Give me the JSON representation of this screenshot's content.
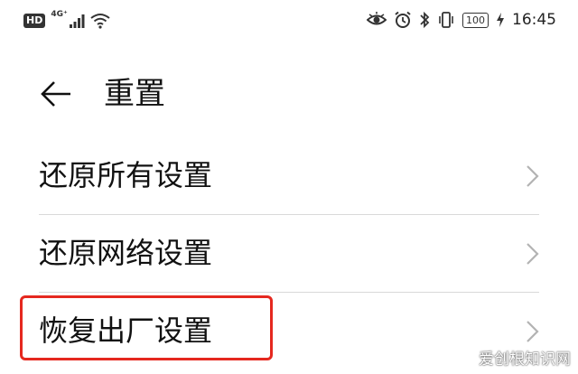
{
  "status_bar": {
    "hd_badge": "HD",
    "network": "4G⁺",
    "battery": "100",
    "time": "16:45",
    "icons": [
      "signal-icon",
      "wifi-icon",
      "eye-icon",
      "alarm-icon",
      "bluetooth-icon",
      "vibrate-icon",
      "charging-icon"
    ]
  },
  "header": {
    "title": "重置",
    "back_icon": "arrow-left-icon"
  },
  "menu": {
    "items": [
      {
        "label": "还原所有设置"
      },
      {
        "label": "还原网络设置"
      },
      {
        "label": "恢复出厂设置"
      }
    ]
  },
  "colors": {
    "highlight": "#e5281f",
    "divider": "#d9d9d9",
    "chevron": "#b3b3b3"
  },
  "watermark": "爱创根知识网"
}
